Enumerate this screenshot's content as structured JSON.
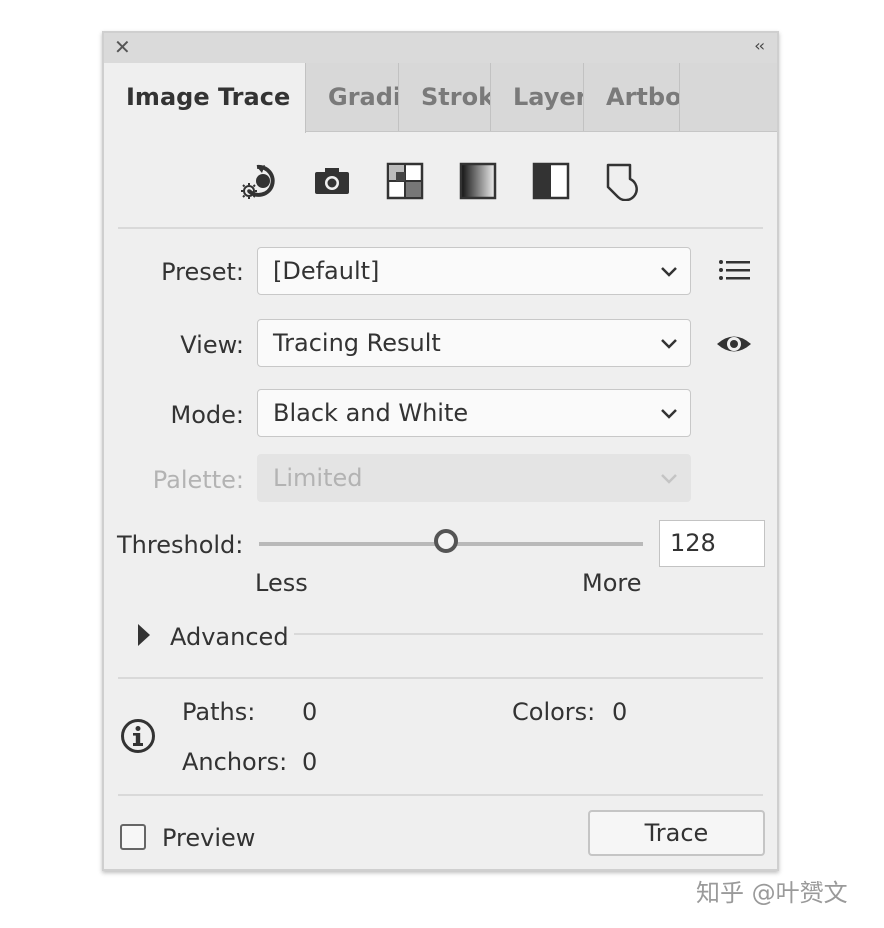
{
  "window": {
    "close_glyph": "✕",
    "collapse_glyph": "‹‹"
  },
  "tabs": [
    {
      "label": "Image Trace",
      "active": true
    },
    {
      "label": "Gradi",
      "active": false
    },
    {
      "label": "Strok",
      "active": false
    },
    {
      "label": "Layer",
      "active": false
    },
    {
      "label": "Artbo",
      "active": false
    }
  ],
  "preset_buttons": [
    {
      "icon": "auto-color-icon"
    },
    {
      "icon": "high-color-photo-icon"
    },
    {
      "icon": "low-color-icon"
    },
    {
      "icon": "grayscale-icon"
    },
    {
      "icon": "black-and-white-icon"
    },
    {
      "icon": "outline-icon"
    }
  ],
  "preset": {
    "label": "Preset:",
    "value": "[Default]"
  },
  "view": {
    "label": "View:",
    "value": "Tracing Result"
  },
  "mode": {
    "label": "Mode:",
    "value": "Black and White"
  },
  "palette": {
    "label": "Palette:",
    "value": "Limited",
    "disabled": true
  },
  "threshold": {
    "label": "Threshold:",
    "value": "128",
    "min_label": "Less",
    "max_label": "More"
  },
  "advanced": {
    "label": "Advanced",
    "expanded": false
  },
  "info": {
    "paths_label": "Paths:",
    "paths_value": "0",
    "colors_label": "Colors:",
    "colors_value": "0",
    "anchors_label": "Anchors:",
    "anchors_value": "0"
  },
  "preview": {
    "label": "Preview",
    "checked": false
  },
  "trace_button": {
    "label": "Trace"
  },
  "watermark": "知乎 @叶赟文",
  "colors": {
    "panel_bg": "#efefef",
    "tab_bar_bg": "#d8d8d8",
    "text": "#333333",
    "disabled_text": "#b3b3b3"
  }
}
